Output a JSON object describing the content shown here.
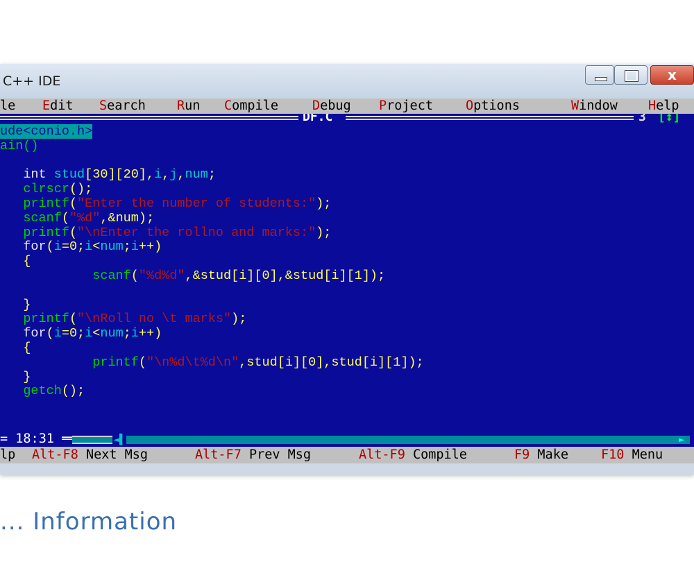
{
  "window": {
    "title": "C++ IDE",
    "close_glyph": "x"
  },
  "menu": {
    "items": [
      {
        "hot": "",
        "rest": "le"
      },
      {
        "hot": "E",
        "rest": "dit"
      },
      {
        "hot": "S",
        "rest": "earch"
      },
      {
        "hot": "R",
        "rest": "un"
      },
      {
        "hot": "C",
        "rest": "ompile"
      },
      {
        "hot": "D",
        "rest": "ebug"
      },
      {
        "hot": "P",
        "rest": "roject"
      },
      {
        "hot": "O",
        "rest": "ptions"
      },
      {
        "hot": "W",
        "rest": "indow"
      },
      {
        "hot": "H",
        "rest": "elp"
      }
    ]
  },
  "editor": {
    "file_name": "DF.C",
    "window_number": "3",
    "resize_glyph": "[↕]",
    "lines": [
      [
        {
          "t": "ude<conio.h>",
          "c": "hl"
        }
      ],
      [
        {
          "t": "ain()",
          "c": "fn"
        }
      ],
      [
        {
          "t": "",
          "c": "kw"
        }
      ],
      [
        {
          "t": "   ",
          "c": "kw"
        },
        {
          "t": "int",
          "c": "kw"
        },
        {
          "t": " stud",
          "c": "id"
        },
        {
          "t": "[30][20]",
          "c": "op"
        },
        {
          "t": ",",
          "c": "op"
        },
        {
          "t": "i",
          "c": "id"
        },
        {
          "t": ",",
          "c": "op"
        },
        {
          "t": "j",
          "c": "id"
        },
        {
          "t": ",",
          "c": "op"
        },
        {
          "t": "num",
          "c": "id"
        },
        {
          "t": ";",
          "c": "op"
        }
      ],
      [
        {
          "t": "   ",
          "c": "kw"
        },
        {
          "t": "clrscr",
          "c": "fn"
        },
        {
          "t": "();",
          "c": "op"
        }
      ],
      [
        {
          "t": "   ",
          "c": "kw"
        },
        {
          "t": "printf",
          "c": "fn"
        },
        {
          "t": "(",
          "c": "op"
        },
        {
          "t": "\"Enter the number of students:\"",
          "c": "str"
        },
        {
          "t": ");",
          "c": "op"
        }
      ],
      [
        {
          "t": "   ",
          "c": "kw"
        },
        {
          "t": "scanf",
          "c": "fn"
        },
        {
          "t": "(",
          "c": "op"
        },
        {
          "t": "\"%d\"",
          "c": "str"
        },
        {
          "t": ",&",
          "c": "op"
        },
        {
          "t": "num",
          "c": "op"
        },
        {
          "t": ");",
          "c": "op"
        }
      ],
      [
        {
          "t": "   ",
          "c": "kw"
        },
        {
          "t": "printf",
          "c": "fn"
        },
        {
          "t": "(",
          "c": "op"
        },
        {
          "t": "\"\\nEnter the rollno and marks:\"",
          "c": "str"
        },
        {
          "t": ");",
          "c": "op"
        }
      ],
      [
        {
          "t": "   ",
          "c": "kw"
        },
        {
          "t": "for",
          "c": "kw"
        },
        {
          "t": "(",
          "c": "op"
        },
        {
          "t": "i",
          "c": "id"
        },
        {
          "t": "=0;",
          "c": "op"
        },
        {
          "t": "i",
          "c": "id"
        },
        {
          "t": "<",
          "c": "op"
        },
        {
          "t": "num",
          "c": "id"
        },
        {
          "t": ";",
          "c": "op"
        },
        {
          "t": "i",
          "c": "id"
        },
        {
          "t": "++)",
          "c": "op"
        }
      ],
      [
        {
          "t": "   ",
          "c": "kw"
        },
        {
          "t": "{",
          "c": "op"
        }
      ],
      [
        {
          "t": "            ",
          "c": "kw"
        },
        {
          "t": "scanf",
          "c": "fn"
        },
        {
          "t": "(",
          "c": "op"
        },
        {
          "t": "\"%d%d\"",
          "c": "str"
        },
        {
          "t": ",&stud[i][0],&stud[i][1]);",
          "c": "op"
        }
      ],
      [
        {
          "t": "",
          "c": "kw"
        }
      ],
      [
        {
          "t": "   ",
          "c": "kw"
        },
        {
          "t": "}",
          "c": "op"
        }
      ],
      [
        {
          "t": "   ",
          "c": "kw"
        },
        {
          "t": "printf",
          "c": "fn"
        },
        {
          "t": "(",
          "c": "op"
        },
        {
          "t": "\"\\nRoll no \\t marks\"",
          "c": "str"
        },
        {
          "t": ");",
          "c": "op"
        }
      ],
      [
        {
          "t": "   ",
          "c": "kw"
        },
        {
          "t": "for",
          "c": "kw"
        },
        {
          "t": "(",
          "c": "op"
        },
        {
          "t": "i",
          "c": "id"
        },
        {
          "t": "=0;",
          "c": "op"
        },
        {
          "t": "i",
          "c": "id"
        },
        {
          "t": "<",
          "c": "op"
        },
        {
          "t": "num",
          "c": "id"
        },
        {
          "t": ";",
          "c": "op"
        },
        {
          "t": "i",
          "c": "id"
        },
        {
          "t": "++)",
          "c": "op"
        }
      ],
      [
        {
          "t": "   ",
          "c": "kw"
        },
        {
          "t": "{",
          "c": "op"
        }
      ],
      [
        {
          "t": "            ",
          "c": "kw"
        },
        {
          "t": "printf",
          "c": "fn"
        },
        {
          "t": "(",
          "c": "op"
        },
        {
          "t": "\"\\n%d\\t%d\\n\"",
          "c": "str"
        },
        {
          "t": ",stud[i][0],stud[i][1]);",
          "c": "op"
        }
      ],
      [
        {
          "t": "   ",
          "c": "kw"
        },
        {
          "t": "}",
          "c": "op"
        }
      ],
      [
        {
          "t": "   ",
          "c": "kw"
        },
        {
          "t": "getch",
          "c": "fn"
        },
        {
          "t": "();",
          "c": "op"
        }
      ]
    ]
  },
  "status": {
    "cursor": "= 18:31 ═══",
    "scroll_thumb": "◄▌",
    "scroll_arrow": "►"
  },
  "hints": {
    "items": [
      {
        "key": "",
        "label": "lp"
      },
      {
        "key": "Alt-F8",
        "label": "Next Msg"
      },
      {
        "key": "Alt-F7",
        "label": "Prev Msg"
      },
      {
        "key": "Alt-F9",
        "label": "Compile"
      },
      {
        "key": "F9",
        "label": "Make"
      },
      {
        "key": "F10",
        "label": "Menu"
      }
    ]
  },
  "page": {
    "bottom_heading": "... Information"
  }
}
